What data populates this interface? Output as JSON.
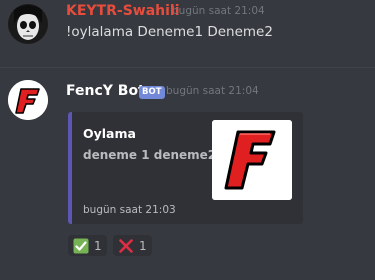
{
  "messages": [
    {
      "username": "KEYTR-Swahili",
      "username_color": "#e74c3c",
      "timestamp": "bugün saat 21:04",
      "text": "!oylalama Deneme1 Deneme2",
      "avatar_icon": "skull-avatar-icon"
    },
    {
      "username": "FencY Bot",
      "username_color": "#ffffff",
      "bot_tag": "BOT",
      "timestamp": "bugün saat 21:04",
      "avatar_icon": "letter-f-avatar-icon",
      "embed": {
        "accent_color": "#5e56b5",
        "title": "Oylama",
        "description": "deneme 1 deneme2",
        "footer": "bugün saat 21:03",
        "thumbnail_icon": "letter-f-thumbnail-icon"
      },
      "reactions": [
        {
          "emoji": "check-mark-icon",
          "count": "1"
        },
        {
          "emoji": "cross-mark-icon",
          "count": "1"
        }
      ]
    }
  ]
}
